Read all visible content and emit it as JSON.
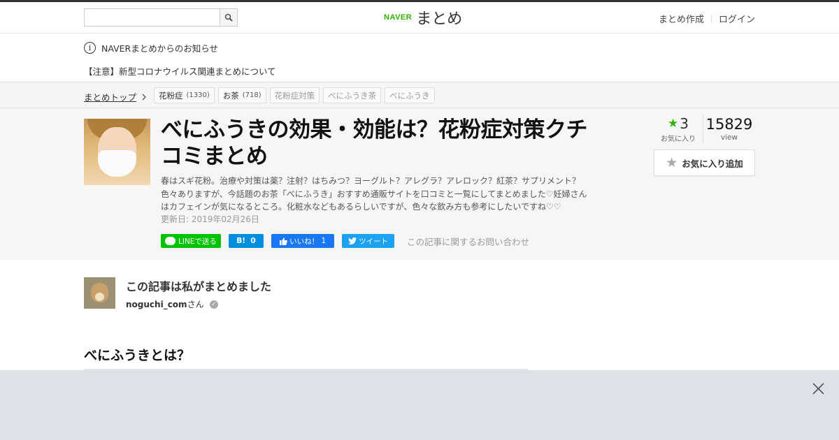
{
  "header": {
    "search_placeholder": "",
    "logo_brand": "NAVER",
    "logo_name": "まとめ",
    "create_label": "まとめ作成",
    "login_label": "ログイン"
  },
  "notice": {
    "title": "NAVERまとめからのお知らせ",
    "item": "【注意】新型コロナウイルス関連まとめについて"
  },
  "breadcrumb": {
    "top_label": "まとめトップ",
    "tags": [
      {
        "label": "花粉症",
        "count": "(1330)"
      },
      {
        "label": "お茶",
        "count": "(718)"
      },
      {
        "label": "花粉症対策"
      },
      {
        "label": "べにふうき茶"
      },
      {
        "label": "べにふうき"
      }
    ]
  },
  "article": {
    "title": "べにふうきの効果・効能は？花粉症対策クチコミまとめ",
    "description": "春はスギ花粉。治療や対策は薬？注射？はちみつ？ヨーグルト？アレグラ？アレロック？紅茶？サプリメント？色々ありますが、今話題のお茶「べにふうき」おすすめ通販サイトを口コミと一覧にしてまとめました♡妊婦さんはカフェインが気になるところ。化粧水などもあるらしいですが、色々な飲み方も参考にしたいですね♡♡",
    "updated": "更新日: 2019年02月26日",
    "favorites_count": "3",
    "favorites_label": "お気に入り",
    "views_count": "15829",
    "views_label": "view",
    "fav_add_label": "お気に入り追加"
  },
  "share": {
    "line_label": "LINEで送る",
    "hatena_label": "B!",
    "hatena_count": "0",
    "like_label": "いいね！",
    "like_count": "1",
    "tweet_label": "ツイート",
    "inquiry_label": "この記事に関するお問い合わせ"
  },
  "author": {
    "heading": "この記事は私がまとめました",
    "name": "noguchi_com",
    "suffix": "さん"
  },
  "section": {
    "heading": "べにふうきとは？"
  },
  "colors": {
    "brand_green": "#2db400",
    "overlay_bg": "#dee2e6"
  }
}
